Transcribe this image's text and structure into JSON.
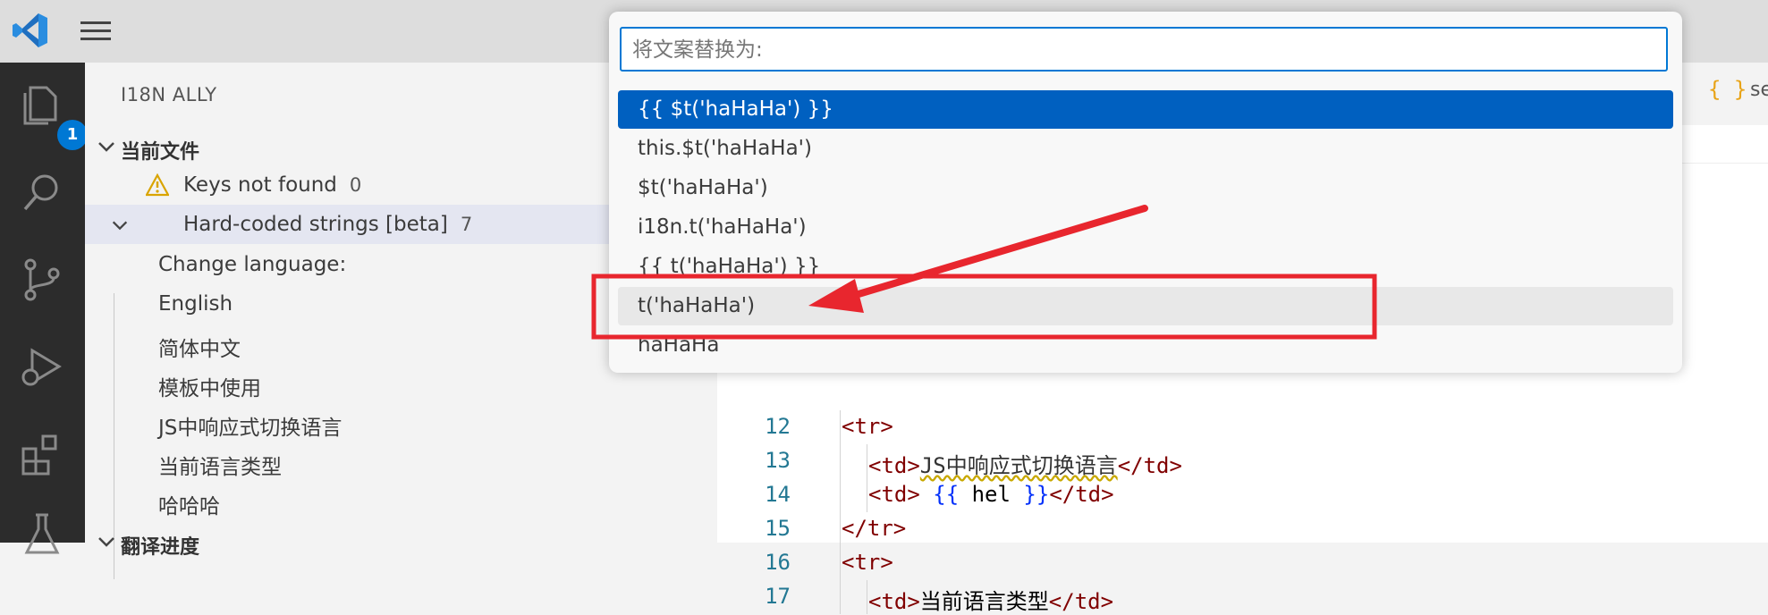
{
  "titlebar": {
    "logo_icon": "vscode-logo-icon",
    "menu_icon": "hamburger-menu-icon"
  },
  "activitybar": {
    "items": [
      {
        "name": "explorer",
        "icon": "files-icon",
        "badge": "1"
      },
      {
        "name": "search",
        "icon": "search-icon"
      },
      {
        "name": "source-control",
        "icon": "source-control-icon"
      },
      {
        "name": "run-debug",
        "icon": "run-debug-icon"
      },
      {
        "name": "extensions",
        "icon": "extensions-icon"
      },
      {
        "name": "testing",
        "icon": "flask-icon"
      }
    ]
  },
  "sidebar": {
    "title": "I18N ALLY",
    "section_current_file": "当前文件",
    "keys_not_found": {
      "label": "Keys not found",
      "count": "0"
    },
    "hardcoded": {
      "label": "Hard-coded strings [beta]",
      "count": "7"
    },
    "strings": [
      "Change language:",
      "English",
      "简体中文",
      "模板中使用",
      "JS中响应式切换语言",
      "当前语言类型",
      "哈哈哈"
    ],
    "section_progress": "翻译进度"
  },
  "editor": {
    "tab_icon": "{ }",
    "tab_label": "se",
    "lines": [
      {
        "num": "12",
        "parts": [
          [
            "tag",
            "<tr>"
          ]
        ]
      },
      {
        "num": "13",
        "parts": [
          [
            "tag",
            "<td>"
          ],
          [
            "sq",
            "JS中响应式切换语言"
          ],
          [
            "tag",
            "</td>"
          ]
        ]
      },
      {
        "num": "14",
        "parts": [
          [
            "tag",
            "<td>"
          ],
          [
            "txtc",
            " "
          ],
          [
            "br",
            "{{"
          ],
          [
            "txtc",
            " hel "
          ],
          [
            "br",
            "}}"
          ],
          [
            "tag",
            "</td>"
          ]
        ]
      },
      {
        "num": "15",
        "parts": [
          [
            "tag",
            "</tr>"
          ]
        ]
      },
      {
        "num": "16",
        "parts": [
          [
            "tag",
            "<tr>"
          ]
        ]
      },
      {
        "num": "17",
        "parts": [
          [
            "tag",
            "<td>"
          ],
          [
            "txtc",
            "当前语言类型"
          ],
          [
            "tag",
            "</td>"
          ]
        ]
      }
    ]
  },
  "quickpick": {
    "placeholder": "将文案替换为:",
    "items": [
      "{{ $t('haHaHa') }}",
      "this.$t('haHaHa')",
      "$t('haHaHa')",
      "i18n.t('haHaHa')",
      "{{ t('haHaHa') }}",
      "t('haHaHa')",
      "haHaHa"
    ],
    "selected_index": 0,
    "hovered_index": 5
  },
  "colors": {
    "accent": "#0078d4",
    "selection": "#0060c0",
    "annotation": "#e8262e"
  }
}
